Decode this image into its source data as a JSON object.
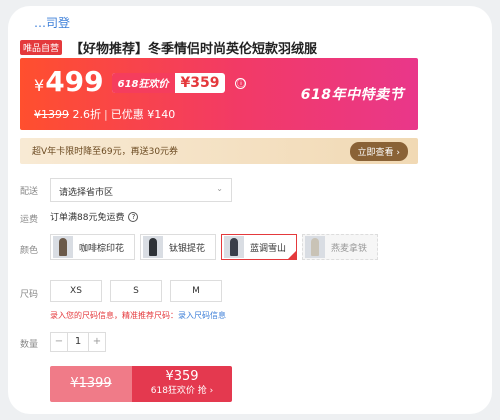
{
  "brand": "…司登",
  "product": {
    "tag": "唯品自营",
    "title": "【好物推荐】冬季情侣时尚英伦短款羽绒服"
  },
  "price": {
    "currency": "¥",
    "current": "499",
    "promo_label": "618狂欢价",
    "promo_price": "¥359",
    "info_icon": "ⓘ",
    "original": "¥1399",
    "discount": "2.6折",
    "saved": "已优惠 ¥140",
    "festival": "618年中特卖节"
  },
  "vip": {
    "text": "超V年卡限时降至69元，再送30元券",
    "button": "立即查看 ›"
  },
  "delivery": {
    "label": "配送",
    "placeholder": "请选择省市区",
    "chevron": "⌄"
  },
  "fee": {
    "label": "运费",
    "text": "订单满88元免运费",
    "help_icon": "?"
  },
  "color": {
    "label": "颜色",
    "options": [
      {
        "name": "咖啡棕印花",
        "state": "normal"
      },
      {
        "name": "钛银提花",
        "state": "normal"
      },
      {
        "name": "蓝调雪山",
        "state": "selected"
      },
      {
        "name": "燕麦拿铁",
        "state": "disabled"
      }
    ]
  },
  "size": {
    "label": "尺码",
    "options": [
      "XS",
      "S",
      "M"
    ],
    "hint_prefix": "录入您的尺码信息，精准推荐尺码：",
    "hint_link": "录入尺码信息"
  },
  "quantity": {
    "label": "数量",
    "minus": "−",
    "value": "1",
    "plus": "+"
  },
  "buy": {
    "original": "¥1399",
    "price": "¥359",
    "label": "618狂欢价 抢 ›"
  },
  "colors": {
    "accent": "#e4393c",
    "banner_start": "#ff4f2e",
    "banner_end": "#e9378a",
    "link": "#3d7fd8"
  }
}
